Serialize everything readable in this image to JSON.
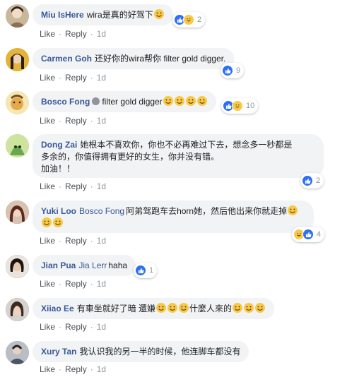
{
  "comments": [
    {
      "author": "Miu IsHere",
      "text": "wira是真的好驾下",
      "emoji_after": [
        "grin-squint-emoji"
      ],
      "reactions": [
        "like",
        "haha"
      ],
      "reaction_count": "2",
      "actions": {
        "like": "Like",
        "reply": "Reply",
        "time": "1d"
      },
      "avatar_color": "#c9b79c"
    },
    {
      "author": "Carmen Goh",
      "text": "还好你的wira帮你 filter gold digger.",
      "reactions": [
        "like"
      ],
      "reaction_count": "9",
      "actions": {
        "like": "Like",
        "reply": "Reply",
        "time": "1d"
      },
      "avatar_color": "#e3b33a"
    },
    {
      "author": "Bosco Fong",
      "text": "filter gold digger",
      "verified_badge": true,
      "emoji_after": [
        "grin-squint-emoji",
        "grin-squint-emoji",
        "grin-squint-emoji",
        "grin-squint-emoji"
      ],
      "reactions": [
        "like",
        "haha"
      ],
      "reaction_count": "10",
      "actions": {
        "like": "Like",
        "reply": "Reply",
        "time": "1d"
      },
      "avatar_color": "#e0c36a"
    },
    {
      "author": "Dong Zai",
      "text_line1": "她根本不喜欢你，你也不必再难过下去，想念多一秒都是",
      "text_line2": "多余的，你值得拥有更好的女生，你并没有错。",
      "text_line3": "加油！！",
      "reactions": [
        "like"
      ],
      "reaction_count": "2",
      "actions": {
        "like": "Like",
        "reply": "Reply",
        "time": "1d"
      },
      "avatar_color": "#a7c95a"
    },
    {
      "author": "Yuki Loo",
      "tag": "Bosco Fong",
      "text": "阿弟驾跑车去horn她，然后他出来你就走掉",
      "emoji_after": [
        "rofl-emoji",
        "rofl-emoji",
        "rofl-emoji"
      ],
      "reactions": [
        "haha",
        "like"
      ],
      "reaction_count": "4",
      "actions": {
        "like": "Like",
        "reply": "Reply",
        "time": "1d"
      },
      "avatar_color": "#b86b5a"
    },
    {
      "author": "Jian Pua",
      "tag": "Jia Lerr",
      "text": "haha",
      "reactions": [
        "like"
      ],
      "reaction_count": "1",
      "actions": {
        "like": "Like",
        "reply": "Reply",
        "time": "1d"
      },
      "avatar_color": "#3a2f2a"
    },
    {
      "author": "Xiiao Ee",
      "text_a": "有車坐就好了暗 還嫌",
      "text_b": "什麼人來的",
      "emoji_mid": [
        "smirk-emoji",
        "smirk-emoji",
        "smirk-emoji"
      ],
      "emoji_after": [
        "smirk-emoji",
        "smirk-emoji",
        "smirk-emoji"
      ],
      "actions": {
        "like": "Like",
        "reply": "Reply",
        "time": "1d"
      },
      "avatar_color": "#6b5a4e"
    },
    {
      "author": "Xury Tan",
      "text": "我认识我的另一半的时候，他连脚车都没有",
      "actions": {
        "like": "Like",
        "reply": "Reply",
        "time": "1d"
      },
      "avatar_color": "#8a8f96"
    }
  ],
  "colors": {
    "author": "#385898",
    "bubble": "#f2f3f5",
    "like_blue": "#2d6ff7",
    "haha_yellow": "#f7c948",
    "meta_gray": "#90949c"
  }
}
